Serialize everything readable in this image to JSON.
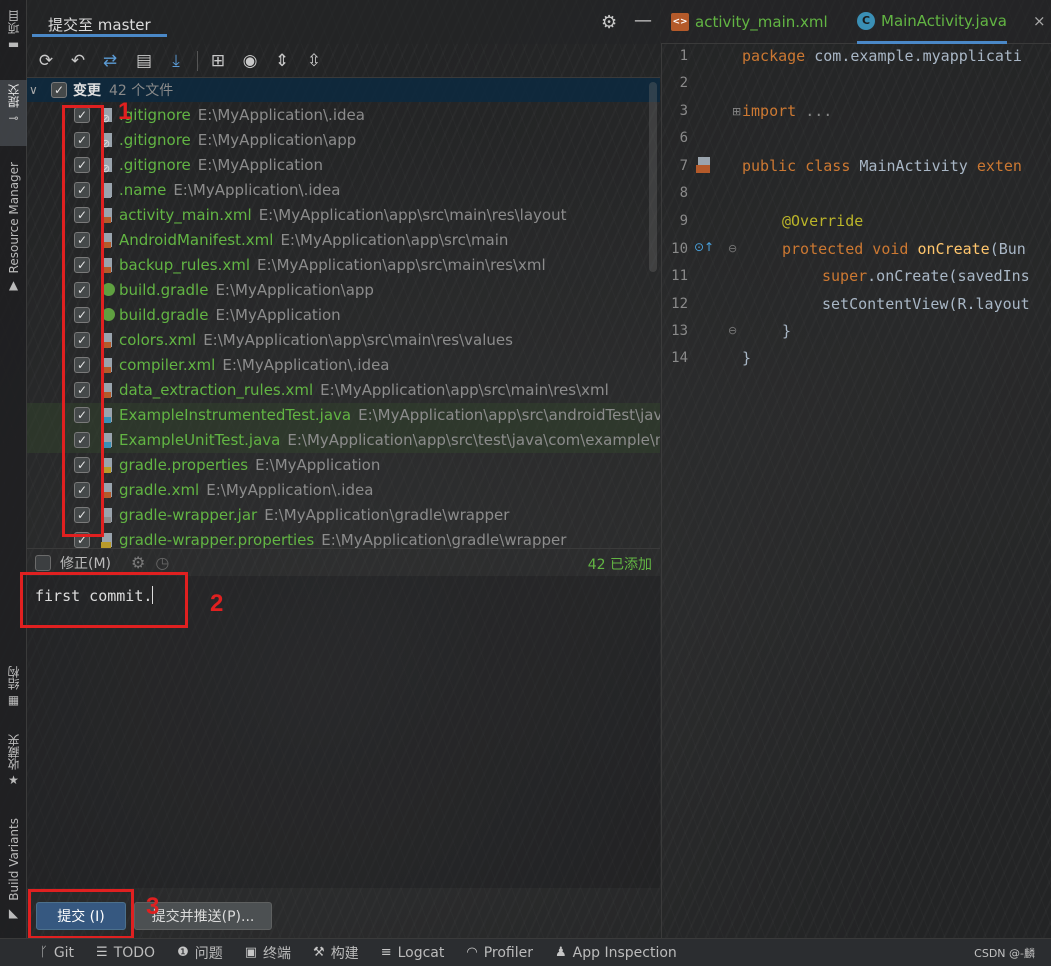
{
  "left_strip": {
    "project_label": "项目",
    "commit_label": "提交",
    "resource_manager_label": "Resource Manager",
    "structure_label": "结构",
    "favorites_label": "收藏夹",
    "build_variants_label": "Build Variants"
  },
  "panel": {
    "title": "提交至 master"
  },
  "changes": {
    "label": "变更",
    "count_text": "42 个文件",
    "files": [
      {
        "name": ".gitignore",
        "path": "E:\\MyApplication\\.idea",
        "icon": "ignore-file-icon"
      },
      {
        "name": ".gitignore",
        "path": "E:\\MyApplication\\app",
        "icon": "ignore-file-icon"
      },
      {
        "name": ".gitignore",
        "path": "E:\\MyApplication",
        "icon": "ignore-file-icon"
      },
      {
        "name": ".name",
        "path": "E:\\MyApplication\\.idea",
        "icon": "text-file-icon"
      },
      {
        "name": "activity_main.xml",
        "path": "E:\\MyApplication\\app\\src\\main\\res\\layout",
        "icon": "xml-file-icon"
      },
      {
        "name": "AndroidManifest.xml",
        "path": "E:\\MyApplication\\app\\src\\main",
        "icon": "xml-file-icon"
      },
      {
        "name": "backup_rules.xml",
        "path": "E:\\MyApplication\\app\\src\\main\\res\\xml",
        "icon": "xml-file-icon"
      },
      {
        "name": "build.gradle",
        "path": "E:\\MyApplication\\app",
        "icon": "gradle-file-icon"
      },
      {
        "name": "build.gradle",
        "path": "E:\\MyApplication",
        "icon": "gradle-file-icon"
      },
      {
        "name": "colors.xml",
        "path": "E:\\MyApplication\\app\\src\\main\\res\\values",
        "icon": "xml-file-icon"
      },
      {
        "name": "compiler.xml",
        "path": "E:\\MyApplication\\.idea",
        "icon": "xml-file-icon"
      },
      {
        "name": "data_extraction_rules.xml",
        "path": "E:\\MyApplication\\app\\src\\main\\res\\xml",
        "icon": "xml-file-icon"
      },
      {
        "name": "ExampleInstrumentedTest.java",
        "path": "E:\\MyApplication\\app\\src\\androidTest\\java",
        "icon": "java-test-file-icon"
      },
      {
        "name": "ExampleUnitTest.java",
        "path": "E:\\MyApplication\\app\\src\\test\\java\\com\\example\\m",
        "icon": "java-test-file-icon"
      },
      {
        "name": "gradle.properties",
        "path": "E:\\MyApplication",
        "icon": "properties-file-icon"
      },
      {
        "name": "gradle.xml",
        "path": "E:\\MyApplication\\.idea",
        "icon": "xml-file-icon"
      },
      {
        "name": "gradle-wrapper.jar",
        "path": "E:\\MyApplication\\gradle\\wrapper",
        "icon": "jar-file-icon"
      },
      {
        "name": "gradle-wrapper.properties",
        "path": "E:\\MyApplication\\gradle\\wrapper",
        "icon": "properties-file-icon"
      }
    ]
  },
  "amend": {
    "label": "修正(M)",
    "added_text": "42 已添加"
  },
  "commit_message": "first commit.",
  "buttons": {
    "commit": "提交 (I)",
    "commit_push": "提交并推送(P)..."
  },
  "annotations": {
    "one": "1",
    "two": "2",
    "three": "3"
  },
  "editor": {
    "tabs": [
      {
        "label": "activity_main.xml",
        "icon": "xml-file-icon"
      },
      {
        "label": "MainActivity.java",
        "icon": "java-class-icon"
      }
    ],
    "line_numbers": [
      "1",
      "2",
      "3",
      "6",
      "7",
      "8",
      "9",
      "10",
      "11",
      "12",
      "13",
      "14"
    ],
    "code": {
      "l1_kw": "package",
      "l1_rest": " com.example.myapplicati",
      "l3_kw": "import",
      "l3_rest": " ...",
      "l7_kw": "public class",
      "l7_name": " MainActivity ",
      "l7_ext": "exten",
      "l9_ann": "@Override",
      "l10_kw": "protected void",
      "l10_fn": " onCreate",
      "l10_rest": "(Bun",
      "l11_kw": "super",
      "l11_rest": ".onCreate(savedIns",
      "l12_rest": "setContentView(R.layout",
      "l13": "}",
      "l14": "}"
    }
  },
  "status_bar": {
    "items": [
      {
        "label": "Git",
        "icon": "git-branch-icon"
      },
      {
        "label": "TODO",
        "icon": "list-icon"
      },
      {
        "label": "问题",
        "icon": "problems-icon"
      },
      {
        "label": "终端",
        "icon": "terminal-icon"
      },
      {
        "label": "构建",
        "icon": "hammer-icon"
      },
      {
        "label": "Logcat",
        "icon": "logcat-icon"
      },
      {
        "label": "Profiler",
        "icon": "profiler-icon"
      },
      {
        "label": "App Inspection",
        "icon": "inspection-icon"
      }
    ],
    "watermark": "CSDN @-麟"
  },
  "colors": {
    "added_file": "#62b543",
    "selection": "#0d293e",
    "accent": "#4a88c7",
    "annotation_red": "#e02020",
    "primary_button": "#365880"
  }
}
